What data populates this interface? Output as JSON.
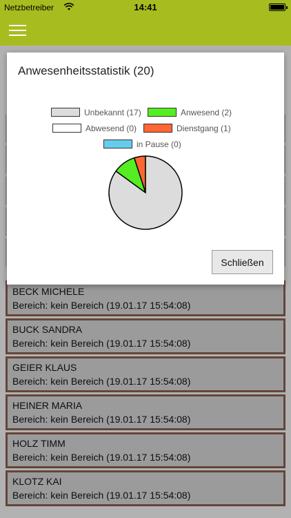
{
  "statusbar": {
    "carrier": "Netzbetreiber",
    "time": "14:41",
    "wifi_icon": "wifi-icon",
    "battery_icon": "battery-icon"
  },
  "navbar": {
    "menu_icon": "hamburger-menu-icon",
    "accent_color": "#a7bd1f"
  },
  "list": {
    "items": [
      {
        "name": "BECK MICHELE",
        "detail": "Bereich: kein Bereich (19.01.17 15:54:08)"
      },
      {
        "name": "BUCK SANDRA",
        "detail": "Bereich: kein Bereich (19.01.17 15:54:08)"
      },
      {
        "name": "GEIER KLAUS",
        "detail": "Bereich: kein Bereich (19.01.17 15:54:08)"
      },
      {
        "name": "HEINER MARIA",
        "detail": "Bereich: kein Bereich (19.01.17 15:54:08)"
      },
      {
        "name": "HOLZ TIMM",
        "detail": "Bereich: kein Bereich (19.01.17 15:54:08)"
      },
      {
        "name": "KLOTZ KAI",
        "detail": "Bereich: kein Bereich (19.01.17 15:54:08)"
      }
    ]
  },
  "modal": {
    "title": "Anwesenheitsstatistik (20)",
    "close_label": "Schließen",
    "legend": [
      {
        "label": "Unbekannt (17)",
        "color": "#dcdcdc"
      },
      {
        "label": "Anwesend (2)",
        "color": "#55ee22"
      },
      {
        "label": "Abwesend (0)",
        "color": "#ffffff"
      },
      {
        "label": "Dienstgang (1)",
        "color": "#ff6633"
      },
      {
        "label": "in Pause (0)",
        "color": "#66ccee"
      }
    ]
  },
  "chart_data": {
    "type": "pie",
    "categories": [
      "Unbekannt",
      "Anwesend",
      "Abwesend",
      "Dienstgang",
      "in Pause"
    ],
    "values": [
      17,
      2,
      0,
      1,
      0
    ],
    "colors": [
      "#dcdcdc",
      "#55ee22",
      "#ffffff",
      "#ff6633",
      "#66ccee"
    ],
    "title": "Anwesenheitsstatistik (20)"
  }
}
